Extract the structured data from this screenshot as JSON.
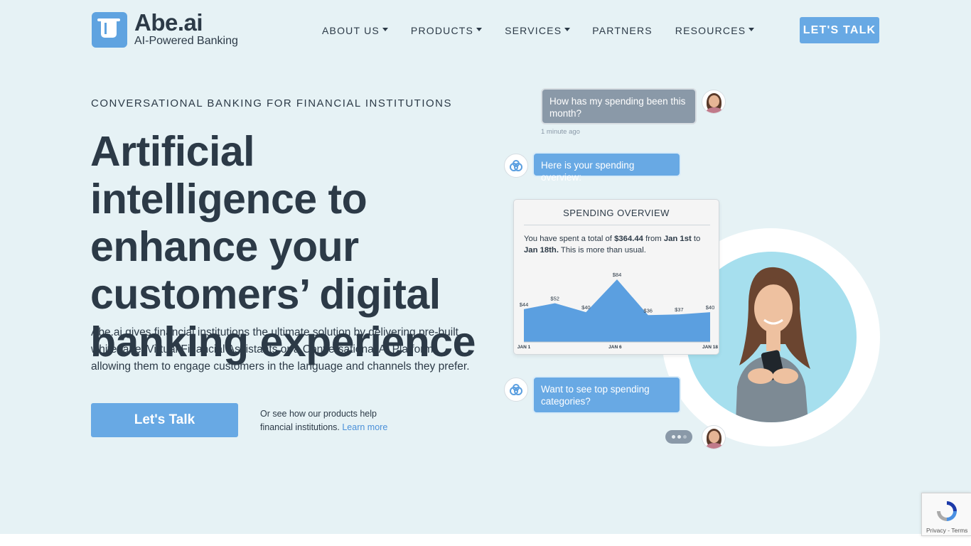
{
  "brand": {
    "name": "Abe.ai",
    "tagline": "AI-Powered Banking",
    "logo_icon": "mug-icon"
  },
  "nav": {
    "items": [
      {
        "label": "ABOUT US",
        "dropdown": true
      },
      {
        "label": "PRODUCTS",
        "dropdown": true
      },
      {
        "label": "SERVICES",
        "dropdown": true
      },
      {
        "label": "PARTNERS",
        "dropdown": false
      },
      {
        "label": "RESOURCES",
        "dropdown": true
      }
    ],
    "cta_label": "LET'S TALK"
  },
  "hero": {
    "eyebrow": "CONVERSATIONAL BANKING FOR FINANCIAL INSTITUTIONS",
    "headline": "Artificial intelligence to enhance your customers’ digital banking experience",
    "description": "Abe.ai gives financial institutions the ultimate solution by delivering pre-built, white-label Virtual Financial Assistants or a Conversational AI Platform allowing them to engage customers in the language and channels they prefer.",
    "cta_label": "Let's Talk",
    "note": "Or see how our products help financial institutions.",
    "note_link": "Learn more"
  },
  "chat": {
    "user_question": "How has my spending been this month?",
    "timestamp": "1 minute ago",
    "bot_reply": "Here is your spending overview:",
    "bot_followup": "Want to see top spending categories?"
  },
  "spending_card": {
    "title": "SPENDING OVERVIEW",
    "text_prefix": "You have spent a total of ",
    "total": "$364.44",
    "text_from": " from ",
    "start_date": "Jan 1st",
    "text_to": " to ",
    "end_date": "Jan 18th.",
    "text_suffix": " This is more than usual."
  },
  "chart_data": {
    "type": "area",
    "x": [
      "JAN 1",
      "",
      "",
      "JAN 6",
      "",
      "",
      "",
      "JAN 18"
    ],
    "tick_labels": [
      "JAN 1",
      "JAN 6",
      "JAN 18"
    ],
    "values": [
      44,
      52,
      40,
      84,
      36,
      37,
      40
    ],
    "value_labels": [
      "$44",
      "$52",
      "$40",
      "$84",
      "$36",
      "$37",
      "$40"
    ],
    "color": "#5b9fe0"
  },
  "colors": {
    "accent": "#68a9e4",
    "hero_bg": "#e6f2f5",
    "text": "#2c3a47"
  },
  "recaptcha": {
    "links": "Privacy - Terms"
  }
}
